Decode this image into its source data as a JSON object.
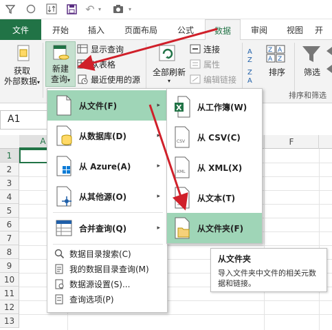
{
  "qat": {
    "undo_label": "↶",
    "camera_label": "▾"
  },
  "tabs": {
    "file": "文件",
    "items": [
      "开始",
      "插入",
      "页面布局",
      "公式",
      "数据",
      "审阅",
      "视图",
      "开"
    ]
  },
  "ribbon": {
    "get_external_data": [
      "获取",
      "外部数据"
    ],
    "get_external_data_arrow": "▾",
    "new_query": [
      "新建",
      "查询"
    ],
    "new_query_arrow": "▾",
    "show_queries": "显示查询",
    "from_table": "从表格",
    "recent_sources": "最近使用的源",
    "refresh_all": "全部刷新",
    "refresh_arrow": "▾",
    "connections": "连接",
    "properties": "属性",
    "edit_links": "编辑链接",
    "sort": "排序",
    "filter": "筛选",
    "sort_filter_group": "排序和筛选"
  },
  "namebox": "A1",
  "grid": {
    "cols": [
      "A",
      "F"
    ],
    "rows": [
      "1",
      "2",
      "3",
      "4",
      "5",
      "6",
      "7",
      "8",
      "9",
      "10",
      "11",
      "12",
      "13"
    ]
  },
  "menu_new_query": {
    "items": [
      {
        "label": "从文件(F)",
        "arrow": "▸"
      },
      {
        "label": "从数据库(D)",
        "arrow": "▸"
      },
      {
        "label": "从 Azure(A)",
        "arrow": "▸"
      },
      {
        "label": "从其他源(O)",
        "arrow": "▸"
      },
      {
        "label": "合并查询(Q)",
        "arrow": "▸"
      }
    ],
    "small_items": [
      "数据目录搜索(C)",
      "我的数据目录查询(M)",
      "数据源设置(S)...",
      "查询选项(P)"
    ]
  },
  "menu_from_file": {
    "items": [
      "从工作簿(W)",
      "从 CSV(C)",
      "从 XML(X)",
      "从文本(T)",
      "从文件夹(F)"
    ],
    "icon_texts": {
      "csv": "CSV",
      "xml": "XML"
    }
  },
  "tooltip": {
    "title": "从文件夹",
    "desc": "导入文件夹中文件的相关元数据和链接。"
  },
  "colors": {
    "accent": "#217346",
    "highlight": "#9fd5b7",
    "arrow": "#d0202a"
  }
}
